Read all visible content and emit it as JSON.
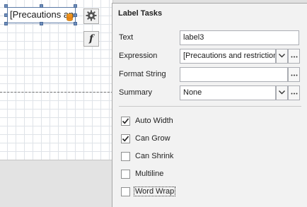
{
  "designer": {
    "label_text": "[Precautions and restrictions]"
  },
  "popup": {
    "title": "Label Tasks",
    "fields": {
      "text": {
        "label": "Text",
        "value": "label3"
      },
      "expression": {
        "label": "Expression",
        "value": "[Precautions and restrictions]"
      },
      "format_string": {
        "label": "Format String",
        "value": ""
      },
      "summary": {
        "label": "Summary",
        "value": "None"
      }
    },
    "options": [
      {
        "label": "Auto Width",
        "checked": true
      },
      {
        "label": "Can Grow",
        "checked": true
      },
      {
        "label": "Can Shrink",
        "checked": false
      },
      {
        "label": "Multiline",
        "checked": false
      },
      {
        "label": "Word Wrap",
        "checked": false,
        "focused": true
      }
    ]
  },
  "icons": [
    "database-icon",
    "gear-icon",
    "function-icon",
    "chevron-down-icon",
    "ellipsis-icon",
    "checkmark-icon"
  ],
  "colors": {
    "accent": "#6f8fbd",
    "selection_border": "#5b7aa6",
    "popup_bg": "#f2f2f2"
  }
}
